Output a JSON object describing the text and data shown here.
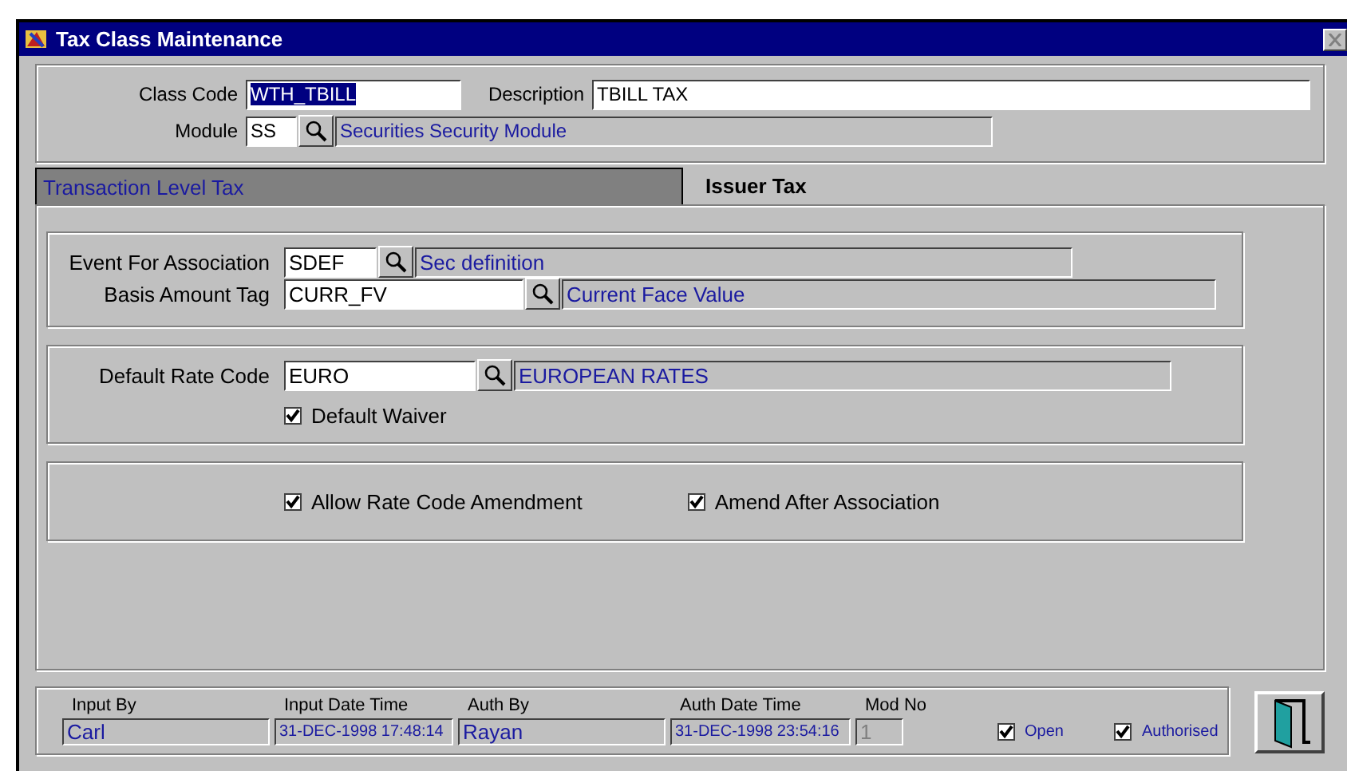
{
  "window": {
    "title": "Tax Class Maintenance"
  },
  "header": {
    "class_code": {
      "label": "Class Code",
      "value": "WTH_TBILL",
      "text_selected": true
    },
    "description": {
      "label": "Description",
      "value": "TBILL TAX"
    },
    "module": {
      "label": "Module",
      "value": "SS",
      "lookup_text": "Securities Security Module"
    }
  },
  "tabs": [
    {
      "label": "Transaction Level Tax",
      "selected": false
    },
    {
      "label": "Issuer Tax",
      "selected": true
    }
  ],
  "groups": [
    {
      "rows": [
        {
          "label": "Event For Association",
          "value": "SDEF",
          "lookup_text": "Sec definition"
        },
        {
          "label": "Basis Amount Tag",
          "value": "CURR_FV",
          "lookup_text": "Current Face Value"
        }
      ]
    },
    {
      "rows": [
        {
          "label": "Default Rate Code",
          "value": "EURO",
          "lookup_text": "EUROPEAN RATES"
        }
      ],
      "checkboxes": [
        {
          "label": "Default Waiver",
          "checked": true
        }
      ]
    },
    {
      "checkboxes": [
        {
          "label": "Allow Rate Code Amendment",
          "checked": true
        },
        {
          "label": "Amend After Association",
          "checked": true
        }
      ]
    }
  ],
  "audit": {
    "fields": [
      {
        "label": "Input By",
        "value": "Carl"
      },
      {
        "label": "Input Date Time",
        "value": "31-DEC-1998 17:48:14"
      },
      {
        "label": "Auth By",
        "value": "Rayan"
      },
      {
        "label": "Auth Date Time",
        "value": "31-DEC-1998 23:54:16"
      },
      {
        "label": "Mod No",
        "value": "1",
        "disabled": true
      }
    ],
    "checkboxes": [
      {
        "label": "Open",
        "checked": true
      },
      {
        "label": "Authorised",
        "checked": true
      }
    ]
  }
}
